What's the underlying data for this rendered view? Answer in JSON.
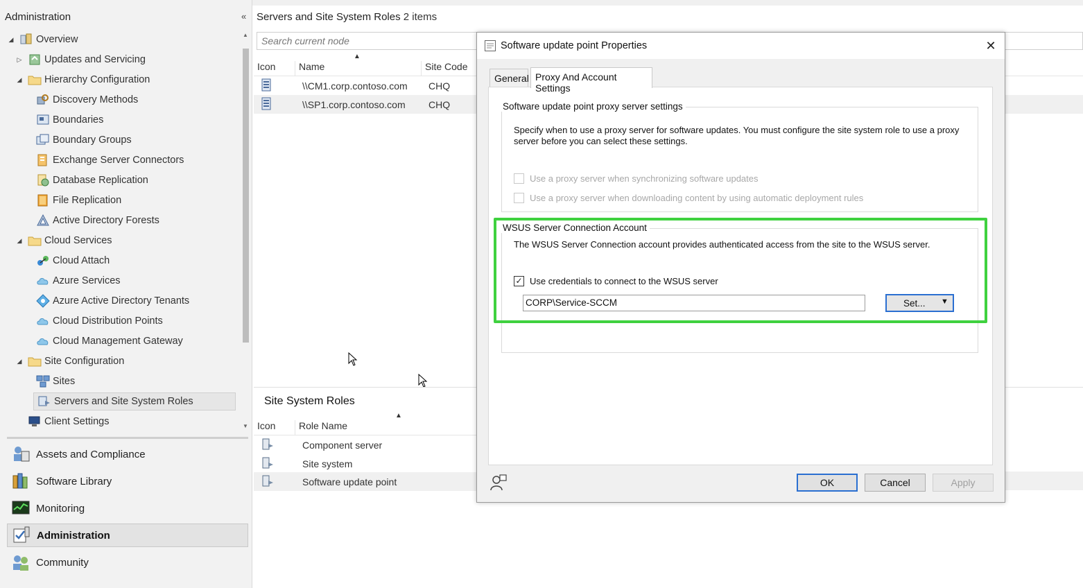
{
  "nav": {
    "header_title": "Administration",
    "collapse_glyph": "«",
    "tree": [
      {
        "label": "Overview",
        "icon": "overview-icon",
        "expander": "◢",
        "level": 0
      },
      {
        "label": "Updates and Servicing",
        "icon": "updates-icon",
        "expander": "▷",
        "level": 1
      },
      {
        "label": "Hierarchy Configuration",
        "icon": "folder-icon",
        "expander": "◢",
        "level": 1
      },
      {
        "label": "Discovery Methods",
        "icon": "discovery-icon",
        "expander": "",
        "level": 2
      },
      {
        "label": "Boundaries",
        "icon": "boundaries-icon",
        "expander": "",
        "level": 2
      },
      {
        "label": "Boundary Groups",
        "icon": "boundary-groups-icon",
        "expander": "",
        "level": 2
      },
      {
        "label": "Exchange Server Connectors",
        "icon": "exchange-icon",
        "expander": "",
        "level": 2
      },
      {
        "label": "Database Replication",
        "icon": "database-icon",
        "expander": "",
        "level": 2
      },
      {
        "label": "File Replication",
        "icon": "file-replication-icon",
        "expander": "",
        "level": 2
      },
      {
        "label": "Active Directory Forests",
        "icon": "ad-forest-icon",
        "expander": "",
        "level": 2
      },
      {
        "label": "Cloud Services",
        "icon": "folder-icon",
        "expander": "◢",
        "level": 1
      },
      {
        "label": "Cloud Attach",
        "icon": "cloud-attach-icon",
        "expander": "",
        "level": 2
      },
      {
        "label": "Azure Services",
        "icon": "cloud-icon",
        "expander": "",
        "level": 2
      },
      {
        "label": "Azure Active Directory Tenants",
        "icon": "aad-icon",
        "expander": "",
        "level": 2
      },
      {
        "label": "Cloud Distribution Points",
        "icon": "cloud-icon",
        "expander": "",
        "level": 2
      },
      {
        "label": "Cloud Management Gateway",
        "icon": "cloud-icon",
        "expander": "",
        "level": 2
      },
      {
        "label": "Site Configuration",
        "icon": "folder-icon",
        "expander": "◢",
        "level": 1
      },
      {
        "label": "Sites",
        "icon": "sites-icon",
        "expander": "",
        "level": 2
      },
      {
        "label": "Servers and Site System Roles",
        "icon": "server-roles-icon",
        "expander": "",
        "level": 2,
        "selected": true
      },
      {
        "label": "Client Settings",
        "icon": "client-settings-icon",
        "expander": "",
        "level": 1
      }
    ],
    "workspaces": [
      {
        "label": "Assets and Compliance",
        "icon": "assets-icon"
      },
      {
        "label": "Software Library",
        "icon": "library-icon"
      },
      {
        "label": "Monitoring",
        "icon": "monitoring-icon"
      },
      {
        "label": "Administration",
        "icon": "administration-icon",
        "active": true
      },
      {
        "label": "Community",
        "icon": "community-icon"
      }
    ]
  },
  "main": {
    "title": "Servers and Site System Roles",
    "count": "2 items",
    "search_placeholder": "Search current node",
    "columns": [
      "Icon",
      "Name",
      "Site Code"
    ],
    "rows": [
      {
        "name": "\\\\CM1.corp.contoso.com",
        "site_code": "CHQ"
      },
      {
        "name": "\\\\SP1.corp.contoso.com",
        "site_code": "CHQ"
      }
    ],
    "roles_title": "Site System Roles",
    "roles_columns": [
      "Icon",
      "Role Name"
    ],
    "roles": [
      "Component server",
      "Site system",
      "Software update point"
    ]
  },
  "dialog": {
    "title": "Software update point Properties",
    "close_glyph": "✕",
    "tabs": [
      "General",
      "Proxy And Account Settings"
    ],
    "proxy_group": {
      "label": "Software update point proxy server settings",
      "description": "Specify when to use a proxy server for software updates. You must configure the site system role to use a proxy server before you can select these settings.",
      "options": [
        {
          "label": "Use a proxy server when synchronizing software updates",
          "checked": false,
          "disabled": true
        },
        {
          "label": "Use a proxy server when downloading content by using automatic deployment rules",
          "checked": false,
          "disabled": true
        }
      ]
    },
    "wsus_group": {
      "label": "WSUS Server Connection Account",
      "description": "The WSUS Server Connection account provides authenticated access from the site to the WSUS server.",
      "use_credentials_label": "Use credentials to connect to the WSUS server",
      "use_credentials_checked": true,
      "check_glyph": "✓",
      "account_value": "CORP\\Service-SCCM",
      "set_label": "Set...",
      "set_arrow": "▼"
    },
    "buttons": {
      "ok": "OK",
      "cancel": "Cancel",
      "apply": "Apply"
    },
    "highlight_color": "#3fd13f"
  }
}
